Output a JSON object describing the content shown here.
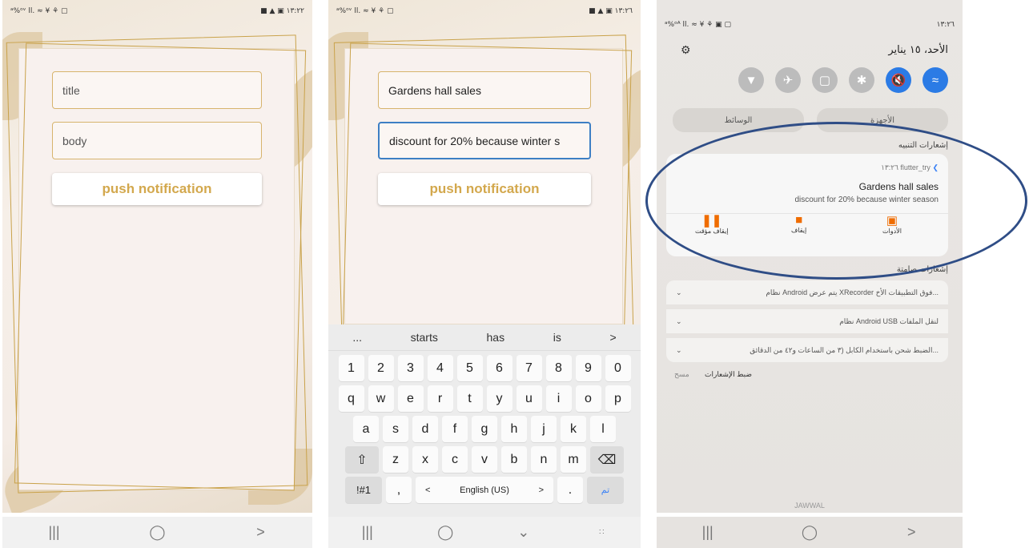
{
  "screen1": {
    "status_left": "ᵃ%ᵒᵛ ll. ≈ ¥ ⚘ ▢",
    "status_right": "■ ▲ ▣ ١٣:٢٢",
    "title_placeholder": "title",
    "body_placeholder": "body",
    "push_button": "push notification"
  },
  "screen2": {
    "status_left": "ᵃ%ᵒᵛ ll. ≈ ¥ ⚘ ▢",
    "status_right": "■ ▲ ▣ ١٣:٢٦",
    "title_value": "Gardens hall sales",
    "body_value": "discount for 20% because winter s",
    "push_button": "push notification",
    "keyboard": {
      "suggestions": [
        "...",
        "starts",
        "has",
        "is",
        ">"
      ],
      "row_numbers": [
        "1",
        "2",
        "3",
        "4",
        "5",
        "6",
        "7",
        "8",
        "9",
        "0"
      ],
      "row_top": [
        "q",
        "w",
        "e",
        "r",
        "t",
        "y",
        "u",
        "i",
        "o",
        "p"
      ],
      "row_mid": [
        "a",
        "s",
        "d",
        "f",
        "g",
        "h",
        "j",
        "k",
        "l"
      ],
      "row_bottom": [
        "z",
        "x",
        "c",
        "v",
        "b",
        "n",
        "m"
      ],
      "shift_key": "⇧",
      "backspace_key": "⌫",
      "symbols_key": "!#1",
      "comma_key": ",",
      "lang_left": "<",
      "language": "English (US)",
      "lang_right": ">",
      "period_key": ".",
      "done_key": "تم"
    }
  },
  "screen3": {
    "status_left": "ᵃ%ᵒᴬ ll. ≈ ¥ ⚘ ▣ ▢",
    "time": "١٣:٢٦",
    "date": "الأحد، ١٥ يناير",
    "media_tab": "الوسائط",
    "devices_tab": "الأجهزة",
    "alerts_header": "إشعارات التنبيه",
    "notif_app": "١٣:٢٦ flutter_try",
    "notif_title": "Gardens hall sales",
    "notif_body": "discount for 20% because winter season",
    "action_pause": "إيقاف مؤقت",
    "action_stop": "إيقاف",
    "action_tools": "الأدوات",
    "silent_header": "إشعارات صامتة",
    "silent_items": [
      "نظام Android  يتم عرض XRecorder فوق التطبيقات الأخ...",
      "نظام Android  USB لنقل الملفات",
      "الضبط  شحن باستخدام الكابل (٣ من الساعات و٤٢ من الدقائق..."
    ],
    "notif_settings": "ضبط الإشعارات",
    "clear": "مسح",
    "carrier": "JAWWAL"
  },
  "navbar": {
    "recents": "|||",
    "home": "◯",
    "back": ">"
  },
  "colors": {
    "gold": "#d3a84d",
    "accent_blue": "#2b7be5",
    "oval": "#2f4d86"
  }
}
